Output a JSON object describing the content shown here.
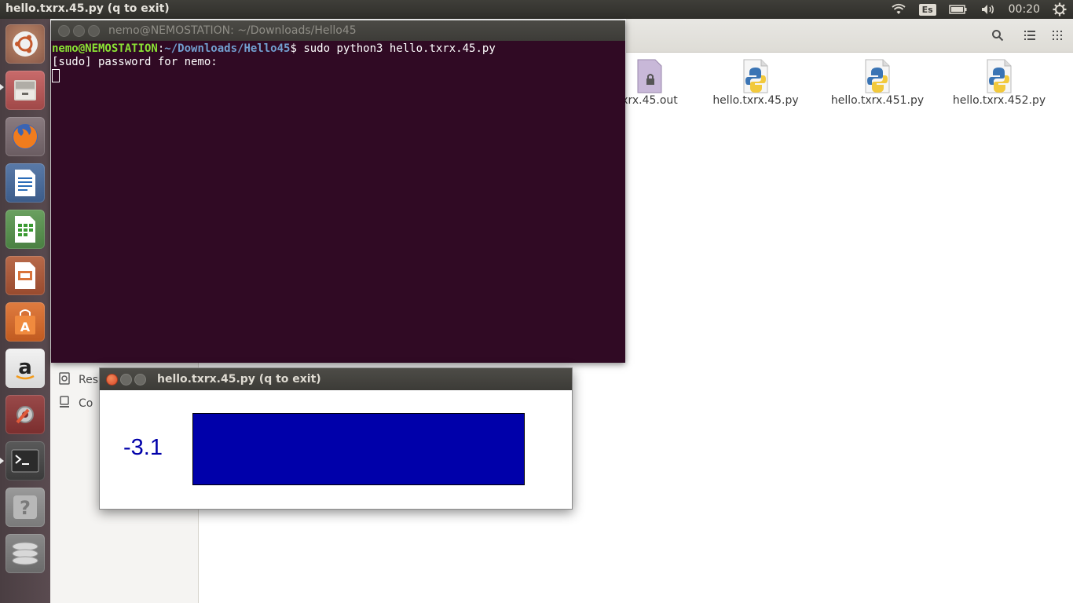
{
  "top_panel": {
    "active_title": "hello.txrx.45.py (q to exit)",
    "keyboard_layout": "Es",
    "clock": "00:20",
    "icons": [
      "wifi-icon",
      "keyboard-icon",
      "battery-icon",
      "volume-icon",
      "gear-icon"
    ]
  },
  "launcher": {
    "items": [
      {
        "name": "ubuntu-dash",
        "icon": "ubuntu-logo-icon"
      },
      {
        "name": "files",
        "icon": "file-cabinet-icon"
      },
      {
        "name": "firefox",
        "icon": "firefox-icon"
      },
      {
        "name": "libreoffice-writer",
        "icon": "writer-icon"
      },
      {
        "name": "libreoffice-calc",
        "icon": "calc-icon"
      },
      {
        "name": "libreoffice-impress",
        "icon": "impress-icon"
      },
      {
        "name": "software-center",
        "icon": "shopping-bag-icon"
      },
      {
        "name": "amazon",
        "icon": "amazon-icon"
      },
      {
        "name": "system-settings",
        "icon": "settings-icon"
      },
      {
        "name": "terminal",
        "icon": "terminal-icon"
      },
      {
        "name": "help",
        "icon": "help-icon"
      },
      {
        "name": "workspaces",
        "icon": "disk-icon"
      }
    ]
  },
  "files_window": {
    "sidebar": {
      "items": [
        {
          "label": "Res",
          "icon": "restore-icon"
        },
        {
          "label": "Co",
          "icon": "computer-icon"
        }
      ]
    },
    "files": [
      {
        "label": "xrx.45.out",
        "icon": "locked-file-icon"
      },
      {
        "label": "hello.txrx.45.py",
        "icon": "python-file-icon"
      },
      {
        "label": "hello.txrx.451.py",
        "icon": "python-file-icon"
      },
      {
        "label": "hello.txrx.452.py",
        "icon": "python-file-icon"
      }
    ]
  },
  "terminal": {
    "title": "nemo@NEMOSTATION: ~/Downloads/Hello45",
    "prompt_user": "nemo@NEMOSTATION",
    "prompt_sep": ":",
    "prompt_path": "~/Downloads/Hello45",
    "prompt_symbol": "$ ",
    "command": "sudo python3 hello.txrx.45.py",
    "output_line": "[sudo] password for nemo:"
  },
  "app_window": {
    "title": "hello.txrx.45.py (q to exit)",
    "value": "-3.1",
    "bar_color": "#0000aa"
  }
}
